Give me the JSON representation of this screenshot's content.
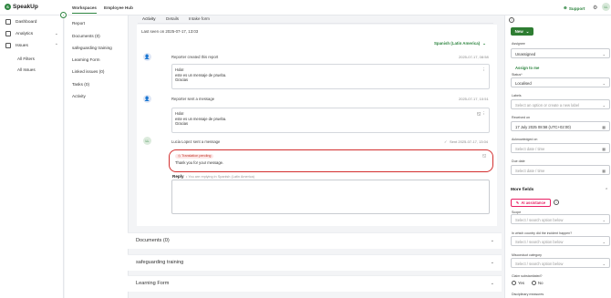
{
  "app": {
    "name": "SpeakUp"
  },
  "topnav": {
    "tabs": [
      "Workspaces",
      "Employee Hub"
    ],
    "support": "Support",
    "user_initials": "LL"
  },
  "leftnav": {
    "items": [
      {
        "label": "Dashboard"
      },
      {
        "label": "Analytics"
      },
      {
        "label": "Issues"
      }
    ],
    "issues_sub": [
      "All Filters",
      "All Issues"
    ]
  },
  "subnav": {
    "items": [
      "Report",
      "Documents (0)",
      "safeguarding training",
      "Learning Form",
      "Linked issues (0)",
      "Tasks (0)",
      "Activity"
    ]
  },
  "main": {
    "tabs": [
      "Activity",
      "Details",
      "Intake form"
    ],
    "last_seen": "Last seen on 2025-07-17, 13:03",
    "language": "Spanish (Latin America)",
    "entries": [
      {
        "actor": "Reporter created this report",
        "time": "2025-07-17, 08:58",
        "lines": [
          "Hola!",
          "este es un mensaje de prueba.",
          "Gracias"
        ]
      },
      {
        "actor": "Reporter sent a message",
        "time": "2025-07-17, 10:51",
        "lines": [
          "Hola!",
          "este es un mensaje de prueba.",
          "Gracias"
        ]
      },
      {
        "actor": "Lucia Lopez sent a message",
        "initials": "LL",
        "time": "Sent 2025-07-17, 13:04",
        "status": "Translation pending",
        "lines": [
          "Thank you for your message."
        ]
      }
    ],
    "reply": {
      "label": "Reply",
      "hint": "You are replying in Spanish (Latin America)"
    }
  },
  "sections": [
    "Documents (0)",
    "safeguarding training",
    "Learning Form"
  ],
  "right": {
    "new_label": "New",
    "assignee_label": "Assignee",
    "assignee_value": "Unassigned",
    "assign_me": "Assign to me",
    "status_label": "Status*",
    "status_value": "Localised",
    "labels_label": "Labels",
    "labels_placeholder": "Select an option or create a new label",
    "received_label": "Received on",
    "received_value": "17 July 2025 08:58 (UTC+02:00)",
    "ack_label": "Acknowledged on",
    "ack_placeholder": "Select date / time",
    "due_label": "Due date",
    "due_placeholder": "Select date / time",
    "more_fields": "More fields",
    "ai_label": "AI assistance",
    "scope_label": "Scope",
    "scope_placeholder": "Select / search option below",
    "country_label": "In which country did the incident happen?",
    "country_placeholder": "Select / search option below",
    "misconduct_label": "Misconduct category",
    "misconduct_placeholder": "Select / search option below",
    "substantiated_label": "Claim substantiated?",
    "yes": "Yes",
    "no": "No",
    "disciplinary_label": "Disciplinary measures"
  }
}
